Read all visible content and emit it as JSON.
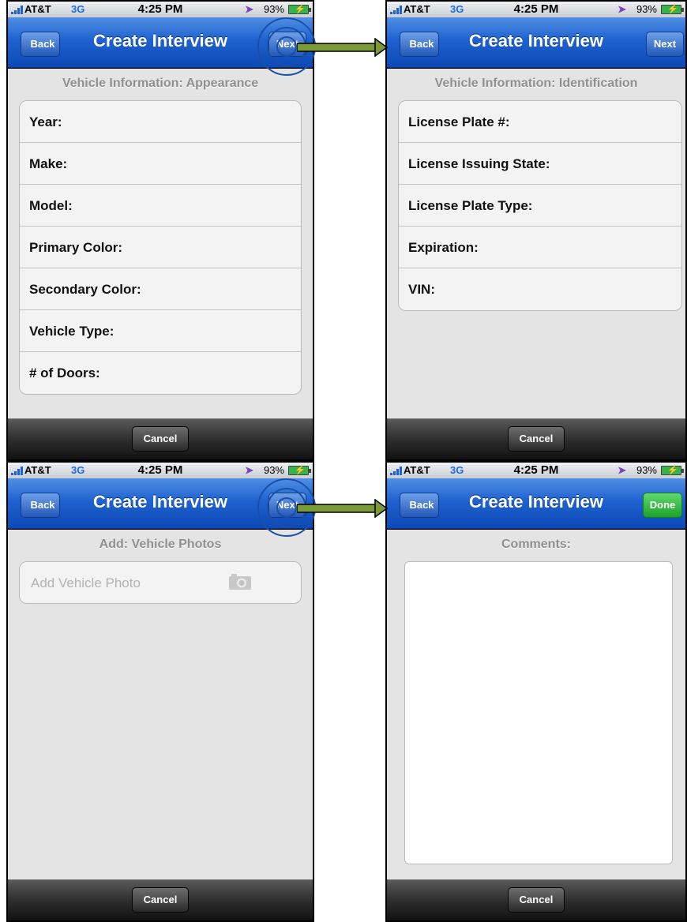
{
  "status_bar": {
    "carrier": "AT&T",
    "network": "3G",
    "time": "4:25 PM",
    "battery": "93%"
  },
  "nav": {
    "title": "Create Interview",
    "back_label": "Back",
    "next_label": "Next",
    "done_label": "Done"
  },
  "toolbar": {
    "cancel_label": "Cancel"
  },
  "screens": {
    "appearance": {
      "header": "Vehicle Information: Appearance",
      "fields": [
        "Year:",
        "Make:",
        "Model:",
        "Primary Color:",
        "Secondary Color:",
        "Vehicle Type:",
        "# of Doors:"
      ]
    },
    "identification": {
      "header": "Vehicle Information: Identification",
      "fields": [
        "License Plate #:",
        "License Issuing State:",
        "License Plate Type:",
        "Expiration:",
        "VIN:"
      ]
    },
    "photos": {
      "header": "Add: Vehicle Photos",
      "add_photo_label": "Add Vehicle Photo"
    },
    "comments": {
      "header": "Comments:"
    }
  },
  "colors": {
    "nav_blue": "#1f62cf",
    "done_green": "#1ea22c",
    "flow_arrow": "#7b9a3a"
  }
}
